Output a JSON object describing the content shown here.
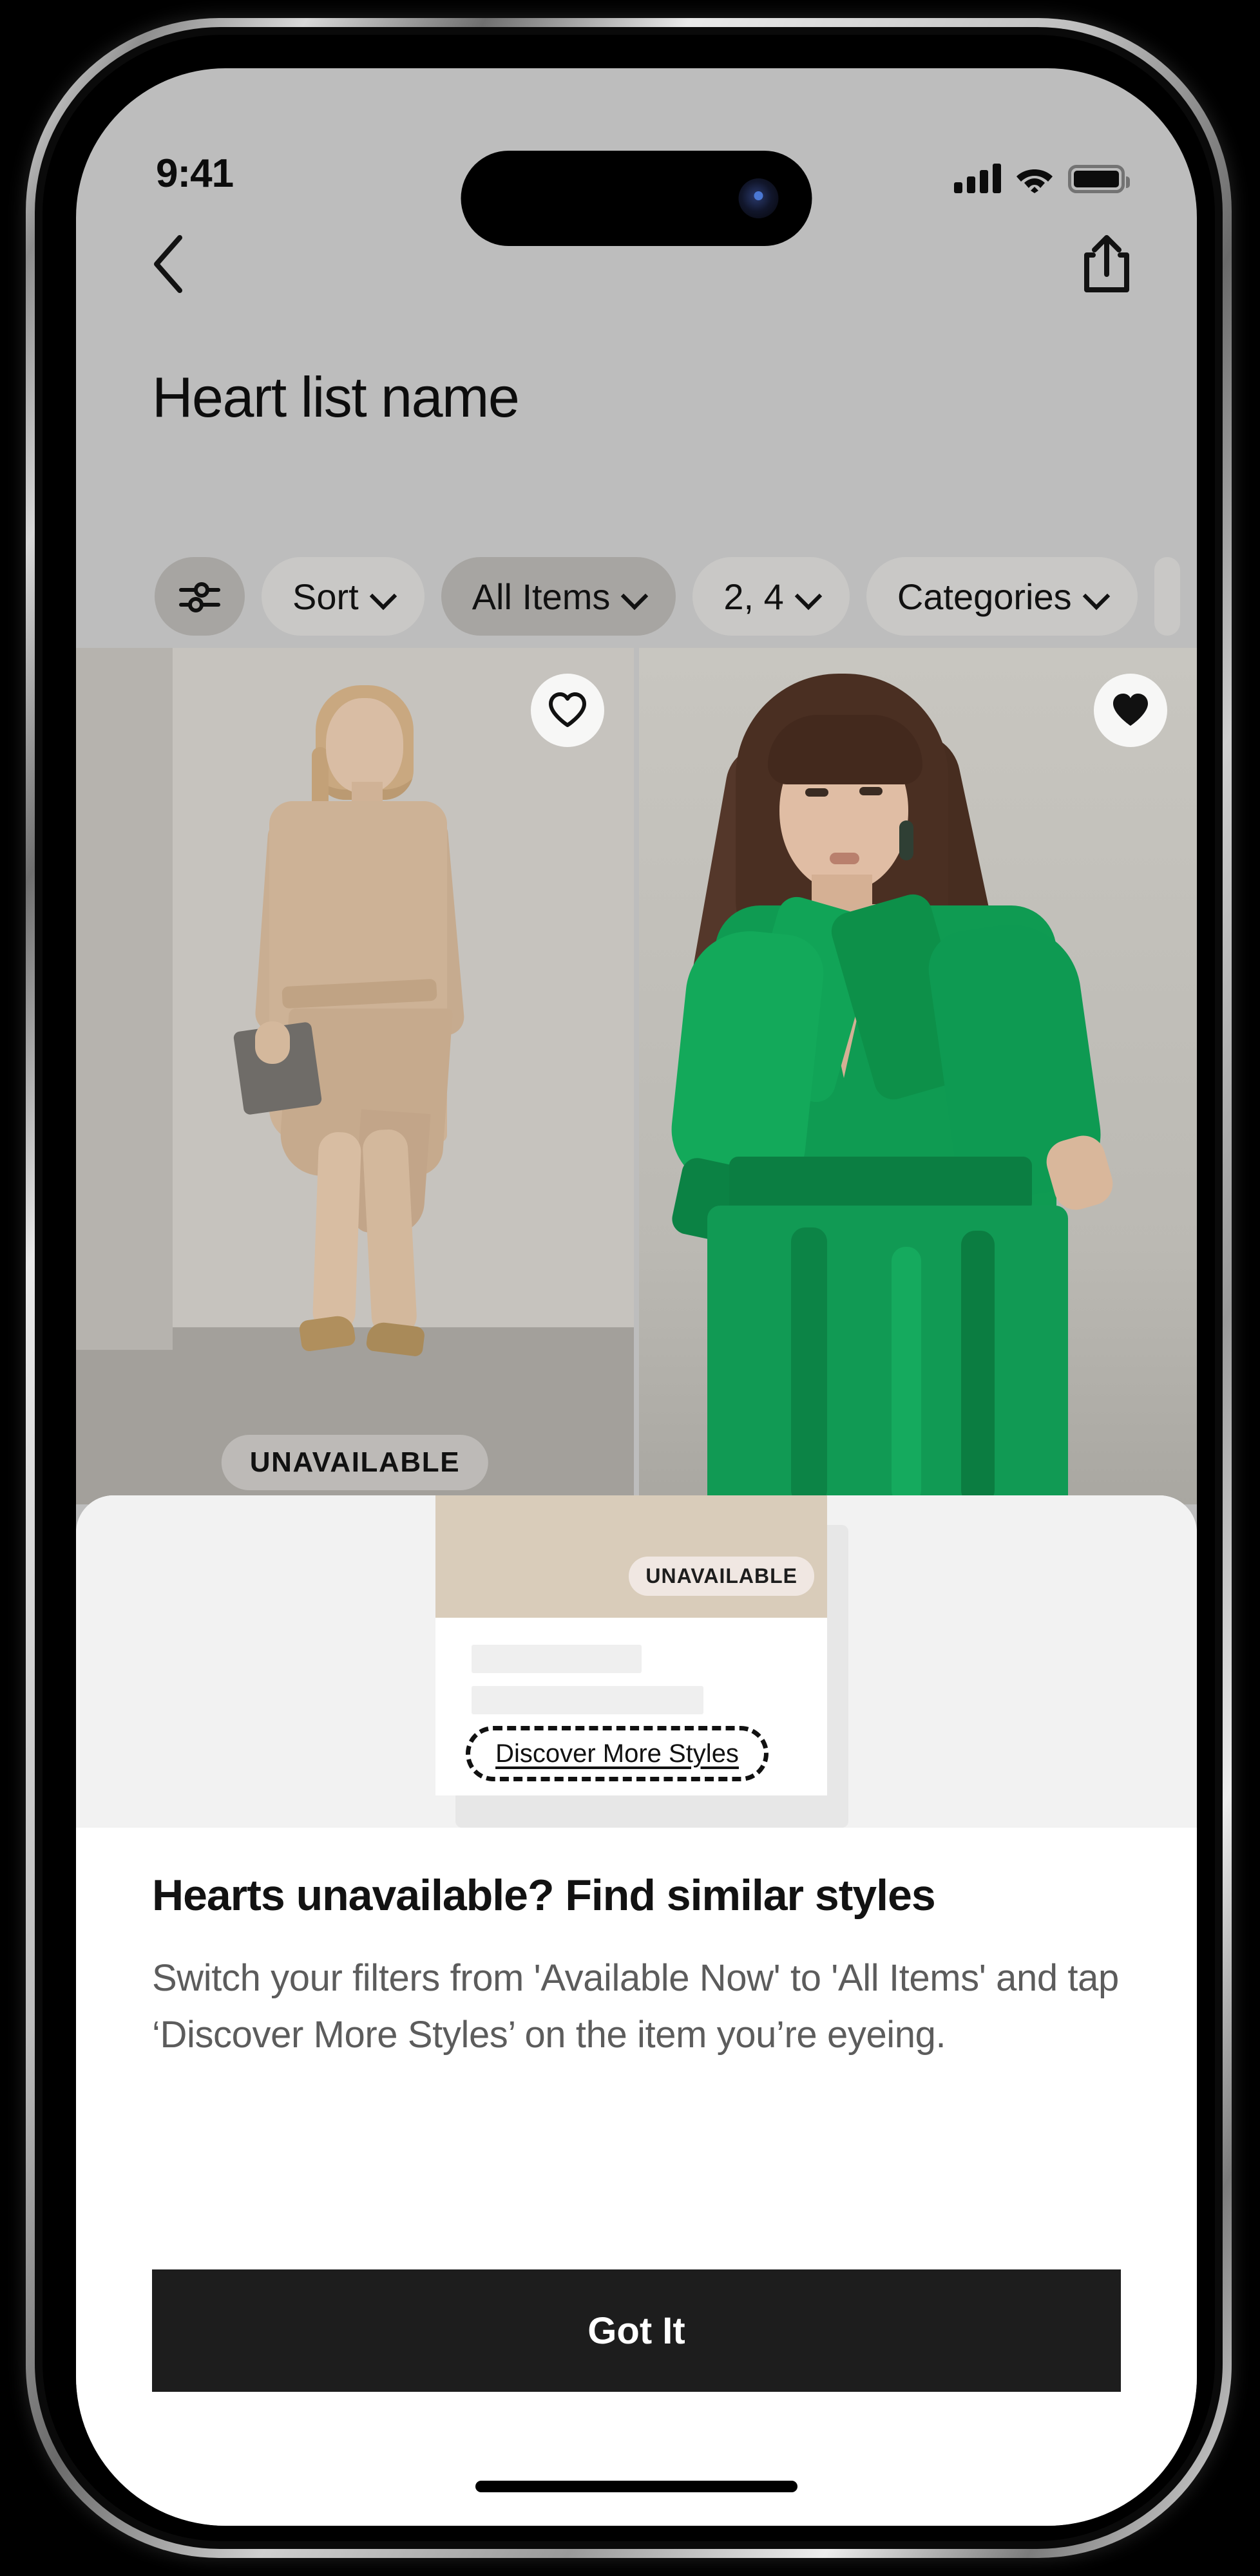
{
  "status_bar": {
    "time": "9:41",
    "signal_icon": "cellular-signal-icon",
    "wifi_icon": "wifi-icon",
    "battery_icon": "battery-full-icon"
  },
  "nav": {
    "back_icon": "chevron-left-icon",
    "share_icon": "share-icon"
  },
  "page": {
    "title": "Heart list name"
  },
  "filters": {
    "chips": [
      {
        "label": "",
        "icon": "filter-sliders-icon",
        "has_caret": false,
        "active": true,
        "icon_only": true
      },
      {
        "label": "Sort",
        "icon": "",
        "has_caret": true,
        "active": false,
        "icon_only": false
      },
      {
        "label": "All Items",
        "icon": "",
        "has_caret": true,
        "active": true,
        "icon_only": false
      },
      {
        "label": "2, 4",
        "icon": "",
        "has_caret": true,
        "active": false,
        "icon_only": false
      },
      {
        "label": "Categories",
        "icon": "",
        "has_caret": true,
        "active": false,
        "icon_only": false
      }
    ]
  },
  "grid": {
    "items": [
      {
        "name": "beige-wrap-dress",
        "favorited": false,
        "heart_icon": "heart-outline-icon",
        "badge": "UNAVAILABLE",
        "has_badge": true
      },
      {
        "name": "green-satin-dress",
        "favorited": true,
        "heart_icon": "heart-filled-icon",
        "badge": "",
        "has_badge": false
      }
    ]
  },
  "sheet": {
    "illustration": {
      "badge": "UNAVAILABLE",
      "cta": "Discover More Styles"
    },
    "headline": "Hearts unavailable? Find similar styles",
    "body": "Switch your filters from 'Available Now' to 'All Items' and tap ‘Discover More Styles’ on the item you’re eyeing.",
    "primary_button": "Got It"
  },
  "colors": {
    "screen_bg": "#bdbdbd",
    "chip_bg": "#c9c8c6",
    "chip_active_bg": "#a7a5a2",
    "sheet_bg": "#ffffff",
    "illus_bg": "#f2f2f2",
    "button_bg": "#1d1d1d",
    "button_text": "#ffffff",
    "body_text": "#5c5c5c",
    "headline_text": "#121212",
    "green_dress": "#0f9b52",
    "beige_dress": "#cdb296"
  }
}
